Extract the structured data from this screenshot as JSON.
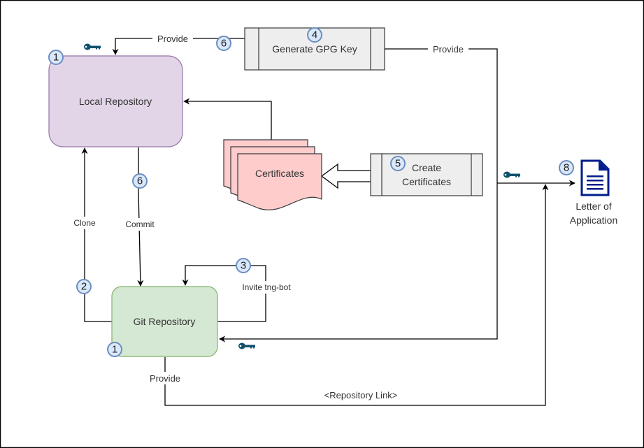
{
  "nodes": {
    "local_repo": {
      "label": "Local Repository",
      "fill": "#e1d5e7",
      "stroke": "#9673a6"
    },
    "git_repo": {
      "label": "Git Repository",
      "fill": "#d5e8d4",
      "stroke": "#82b366"
    },
    "gpg_key": {
      "label": "Generate GPG Key",
      "fill": "#eeeeee",
      "stroke": "#36393d"
    },
    "create_certs": {
      "label_line1": "Create",
      "label_line2": "Certificates",
      "fill": "#eeeeee",
      "stroke": "#36393d"
    },
    "certificates": {
      "label": "Certificates",
      "fill": "#ffcccc",
      "stroke": "#36393d"
    },
    "letter": {
      "label_line1": "Letter of",
      "label_line2": "Application",
      "icon_color": "#001d8b"
    }
  },
  "edges": {
    "gpg_to_local": "Provide",
    "gpg_to_letter": "Provide",
    "clone": "Clone",
    "commit": "Commit",
    "invite": "Invite tng-bot",
    "git_provide": "Provide",
    "repo_link": "<Repository Link>"
  },
  "badges": {
    "local_repo": "1",
    "git_repo": "1",
    "clone": "2",
    "invite": "3",
    "gpg_key": "4",
    "create_certs": "5",
    "gpg_provide": "6",
    "commit": "6",
    "letter": "8"
  },
  "icons": {
    "key_color": "#10516e"
  }
}
